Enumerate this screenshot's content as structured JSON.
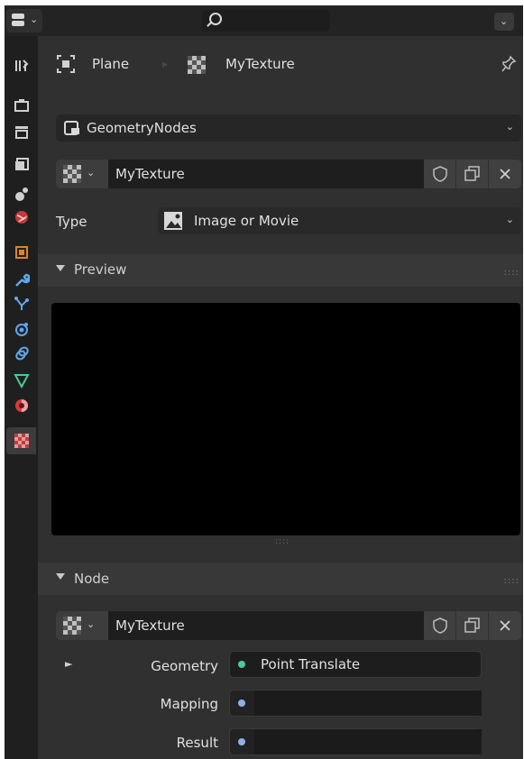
{
  "header": {
    "search_placeholder": ""
  },
  "breadcrumb": {
    "object": "Plane",
    "texture": "MyTexture"
  },
  "modifier_select": {
    "value": "GeometryNodes"
  },
  "texture_slot": {
    "name": "MyTexture"
  },
  "type_row": {
    "label": "Type",
    "value": "Image or Movie"
  },
  "preview_panel": {
    "title": "Preview"
  },
  "node_panel": {
    "title": "Node",
    "texture_name": "MyTexture",
    "inputs": [
      {
        "label": "Geometry",
        "value": "Point Translate",
        "socket_color": "#4fc79d"
      },
      {
        "label": "Mapping",
        "value": "",
        "socket_color": "#8fb0e8"
      },
      {
        "label": "Result",
        "value": "",
        "socket_color": "#8fb0e8"
      }
    ]
  },
  "sidebar_tabs": [
    "tool-icon",
    "render-icon",
    "output-icon",
    "view-layer-icon",
    "scene-icon",
    "world-icon",
    "object-icon",
    "modifier-icon",
    "particles-icon",
    "physics-icon",
    "constraints-icon",
    "data-icon",
    "material-icon",
    "texture-icon"
  ]
}
